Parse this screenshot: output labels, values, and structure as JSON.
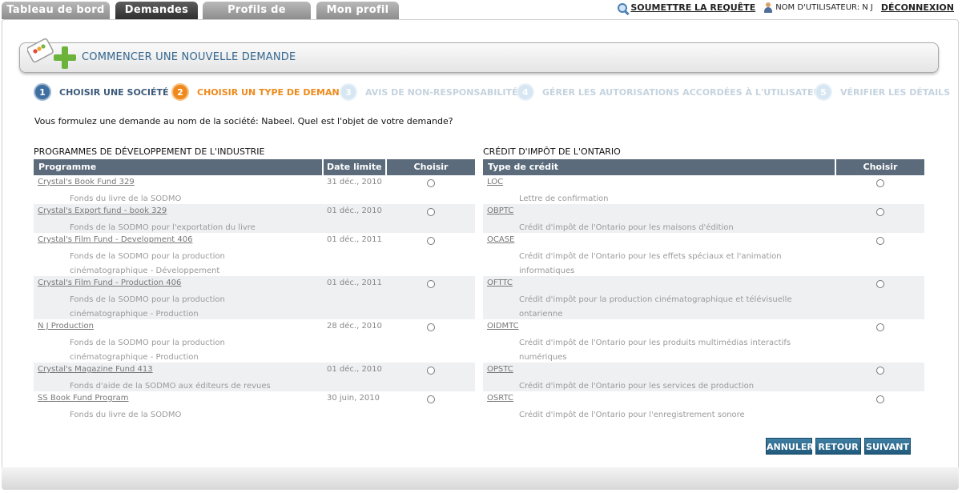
{
  "tabs": [
    {
      "label": "Tableau de bord",
      "active": false
    },
    {
      "label": "Demandes",
      "active": true
    },
    {
      "label": "Profils de sociétés",
      "active": false
    },
    {
      "label": "Mon profil",
      "active": false
    }
  ],
  "topbar": {
    "submit_label": "SOUMETTRE LA REQUÊTE",
    "user_label": "NOM D'UTILISATEUR: N J",
    "logout_label": "DÉCONNEXION"
  },
  "banner": {
    "title": "COMMENCER UNE NOUVELLE DEMANDE"
  },
  "steps": [
    {
      "number": "1",
      "label": "CHOISIR UNE SOCIÉTÉ",
      "state": "done"
    },
    {
      "number": "2",
      "label": "CHOISIR UN TYPE DE DEMANDE",
      "state": "current"
    },
    {
      "number": "3",
      "label": "AVIS DE NON-RESPONSABILITÉ",
      "state": "todo"
    },
    {
      "number": "4",
      "label": "GÉRER LES AUTORISATIONS ACCORDÉES À L'UTILISATEUR",
      "state": "todo"
    },
    {
      "number": "5",
      "label": "VÉRIFIER LES DÉTAILS",
      "state": "todo"
    }
  ],
  "question": "Vous formulez une demande au nom de la société: Nabeel. Quel est l'objet de votre demande?",
  "programs": {
    "title": "PROGRAMMES DE DÉVELOPPEMENT DE L'INDUSTRIE",
    "col_program": "Programme",
    "col_deadline": "Date limite",
    "col_choose": "Choisir",
    "rows": [
      {
        "name": "Crystal's Book Fund 329",
        "desc": [
          "Fonds du livre de la SODMO"
        ],
        "date": "31 déc., 2010"
      },
      {
        "name": "Crystal's Export fund - book 329",
        "desc": [
          "Fonds de la SODMO pour l'exportation du livre"
        ],
        "date": "01 déc., 2010"
      },
      {
        "name": "Crystal's Film Fund - Development 406",
        "desc": [
          "Fonds de la SODMO pour la production",
          "cinématographique - Développement"
        ],
        "date": "01 déc., 2011"
      },
      {
        "name": "Crystal's Film Fund - Production 406",
        "desc": [
          "Fonds de la SODMO pour la production",
          "cinématographique - Production"
        ],
        "date": "01 déc., 2011"
      },
      {
        "name": "N J Production",
        "desc": [
          "Fonds de la SODMO pour la production",
          "cinématographique - Production"
        ],
        "date": "28 déc., 2010"
      },
      {
        "name": "Crystal's Magazine Fund 413",
        "desc": [
          "Fonds d'aide de la SODMO aux éditeurs de revues"
        ],
        "date": "01 déc., 2010"
      },
      {
        "name": "SS Book Fund Program",
        "desc": [
          "Fonds du livre de la SODMO"
        ],
        "date": "30 juin, 2010"
      }
    ]
  },
  "credits": {
    "title": "CRÉDIT D'IMPÔT DE L'ONTARIO",
    "col_type": "Type de crédit",
    "col_choose": "Choisir",
    "rows": [
      {
        "name": "LOC",
        "desc": [
          "Lettre de confirmation"
        ]
      },
      {
        "name": "OBPTC",
        "desc": [
          "Crédit d'impôt de l'Ontario pour les maisons d'édition"
        ]
      },
      {
        "name": "OCASE",
        "desc": [
          "Crédit d'impôt de l'Ontario pour les effets spéciaux et l'animation",
          "informatiques"
        ]
      },
      {
        "name": "OFTTC",
        "desc": [
          "Crédit d'impôt pour la production cinématographique et télévisuelle",
          "ontarienne"
        ]
      },
      {
        "name": "OIDMTC",
        "desc": [
          "Crédit d'impôt de l'Ontario pour les produits multimédias interactifs",
          "numériques"
        ]
      },
      {
        "name": "OPSTC",
        "desc": [
          "Crédit d'impôt de l'Ontario pour les services de production"
        ]
      },
      {
        "name": "OSRTC",
        "desc": [
          "Crédit d'impôt de l'Ontario pour l'enregistrement sonore"
        ]
      }
    ]
  },
  "buttons": {
    "cancel": "ANNULER",
    "back": "RETOUR",
    "next": "SUIVANT"
  }
}
